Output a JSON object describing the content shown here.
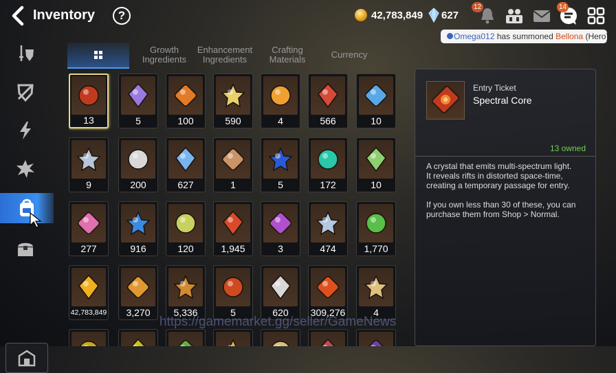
{
  "header": {
    "title": "Inventory",
    "help_label": "?",
    "gold": "42,783,849",
    "crystals": "627",
    "notif_badge": "12",
    "chat_badge": "14"
  },
  "chat": {
    "user": "Omega012",
    "mid": " has summoned ",
    "hero": "Bellona",
    "suffix": " (Hero)"
  },
  "tabs": [
    {
      "label": "",
      "icon": "grid-icon",
      "active": true
    },
    {
      "label": "Growth\nIngredients",
      "active": false
    },
    {
      "label": "Enhancement\nIngredients",
      "active": false
    },
    {
      "label": "Crafting\nMaterials",
      "active": false
    },
    {
      "label": "Currency",
      "active": false
    }
  ],
  "sidebar": [
    {
      "icon": "sword-shield-icon",
      "active": false
    },
    {
      "icon": "shield-icon",
      "active": false
    },
    {
      "icon": "lightning-icon",
      "active": false
    },
    {
      "icon": "burst-icon",
      "active": false
    },
    {
      "icon": "backpack-icon",
      "active": true
    },
    {
      "icon": "chest-icon",
      "active": false
    }
  ],
  "sidebar_bottom_icon": "store-icon",
  "items": [
    {
      "count": "13",
      "color": "#c23a1e",
      "selected": true
    },
    {
      "count": "5",
      "color": "#9a7ae0"
    },
    {
      "count": "100",
      "color": "#e07b2a"
    },
    {
      "count": "590",
      "color": "#e8d06a"
    },
    {
      "count": "4",
      "color": "#f0a030"
    },
    {
      "count": "566",
      "color": "#d64a3a"
    },
    {
      "count": "10",
      "color": "#58a8e8"
    },
    {
      "count": "9",
      "color": "#b8c4d8"
    },
    {
      "count": "200",
      "color": "#d8d8d8"
    },
    {
      "count": "627",
      "color": "#7ab4f0"
    },
    {
      "count": "1",
      "color": "#c89468"
    },
    {
      "count": "5",
      "color": "#2a5ad8"
    },
    {
      "count": "172",
      "color": "#28c8a8"
    },
    {
      "count": "10",
      "color": "#8ed070"
    },
    {
      "count": "277",
      "color": "#e070b0"
    },
    {
      "count": "916",
      "color": "#3a8ae0"
    },
    {
      "count": "120",
      "color": "#c8d060"
    },
    {
      "count": "1,945",
      "color": "#d84a2a"
    },
    {
      "count": "3",
      "color": "#b050d0"
    },
    {
      "count": "474",
      "color": "#b0c8e0"
    },
    {
      "count": "1,770",
      "color": "#58c048"
    },
    {
      "count": "42,783,849",
      "color": "#f0b020",
      "small": true
    },
    {
      "count": "3,270",
      "color": "#e09830"
    },
    {
      "count": "5,336",
      "color": "#d08a30"
    },
    {
      "count": "5",
      "color": "#d04a20"
    },
    {
      "count": "620",
      "color": "#d8d8d8"
    },
    {
      "count": "309,276",
      "color": "#e0501e"
    },
    {
      "count": "4",
      "color": "#e0c080"
    },
    {
      "count": "",
      "color": "#c8a820"
    },
    {
      "count": "",
      "color": "#c8c020"
    },
    {
      "count": "",
      "color": "#60b040"
    },
    {
      "count": "",
      "color": "#e0b040"
    },
    {
      "count": "",
      "color": "#d8c080"
    },
    {
      "count": "",
      "color": "#c04a50"
    },
    {
      "count": "",
      "color": "#7040a0"
    }
  ],
  "detail": {
    "category": "Entry Ticket",
    "name": "Spectral Core",
    "owned": "13 owned",
    "desc1": "A crystal that emits multi-spectrum light.\nIt reveals rifts in distorted space-time, creating a temporary passage for entry.",
    "desc2": "If you own less than 30 of these, you can purchase them from Shop > Normal."
  },
  "watermark": "https://gamemarket.gg/seller/GameNews"
}
